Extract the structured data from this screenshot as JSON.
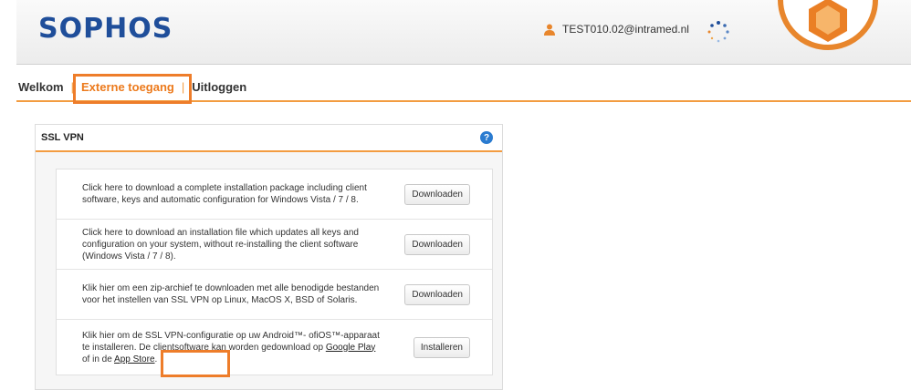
{
  "header": {
    "logo": "SOPHOS",
    "user_email": "TEST010.02@intramed.nl"
  },
  "nav": {
    "items": [
      "Welkom",
      "Externe toegang",
      "Uitloggen"
    ],
    "active_index": 1
  },
  "panel": {
    "title": "SSL VPN",
    "rows": [
      {
        "text": "Click here to download a complete installation package including client software, keys and automatic configuration for Windows Vista / 7 / 8.",
        "button": "Downloaden"
      },
      {
        "text": "Click here to download an installation file which updates all keys and configuration on your system, without re-installing the client software (Windows Vista / 7 / 8).",
        "button": "Downloaden"
      },
      {
        "text": "Klik hier om een zip-archief te downloaden met alle benodigde bestanden voor het instellen van SSL VPN op Linux, MacOS X, BSD of Solaris.",
        "button": "Downloaden"
      },
      {
        "text_before": "Klik hier om de SSL VPN-configuratie op uw Android™- ofiOS™-apparaat te installeren. De clientsoftware kan worden gedownload op ",
        "link_google": "Google Play",
        "text_middle": " of in de ",
        "link_appstore": "App Store",
        "text_after": ".",
        "button": "Installeren"
      }
    ]
  },
  "colors": {
    "accent": "#f39c41",
    "highlight": "#ee7d2a",
    "brand": "#1f4e9a",
    "help": "#2a7bd0"
  }
}
